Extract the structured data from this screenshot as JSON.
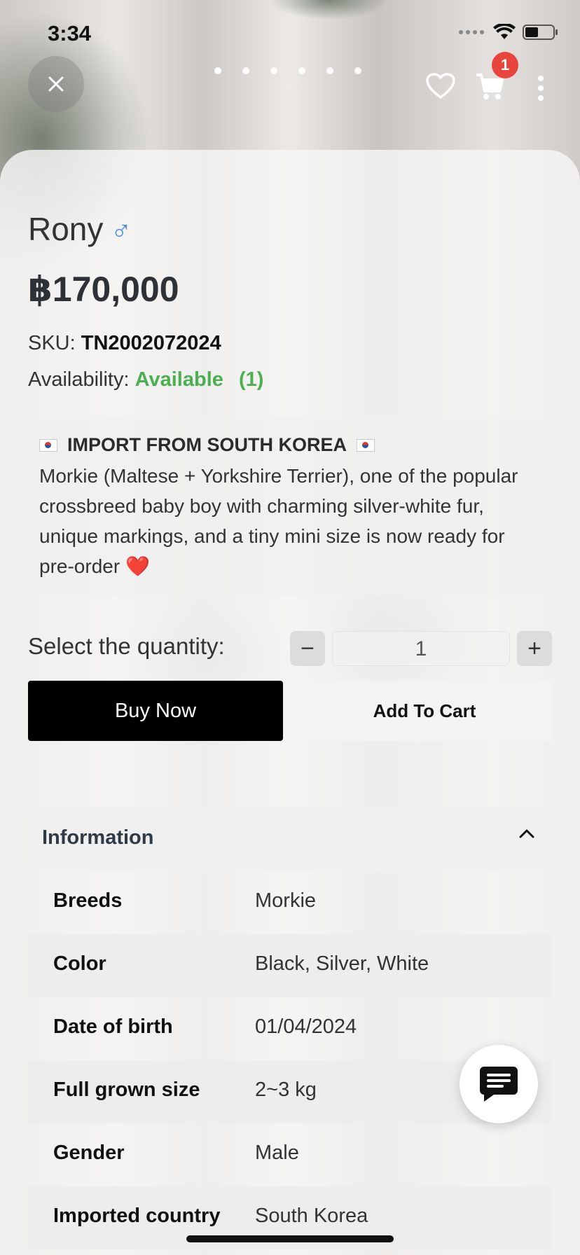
{
  "status_bar": {
    "time": "3:34"
  },
  "gallery": {
    "dot_count": 6,
    "active_index": 0
  },
  "cart": {
    "badge_count": "1"
  },
  "product": {
    "name": "Rony",
    "gender_symbol": "♂",
    "price": "฿170,000",
    "sku_label": "SKU:",
    "sku_value": "TN2002072024",
    "availability_label": "Availability:",
    "availability_value": "Available",
    "availability_count": "(1)",
    "description_title": "IMPORT FROM SOUTH KOREA",
    "description_text": "Morkie (Maltese + Yorkshire Terrier), one of the popular crossbreed baby boy with charming silver-white fur, unique markings, and a tiny mini size is now ready for pre-order ❤️"
  },
  "quantity": {
    "label": "Select the quantity:",
    "value": "1",
    "minus": "−",
    "plus": "+"
  },
  "actions": {
    "buy_now": "Buy Now",
    "add_to_cart": "Add To Cart"
  },
  "information": {
    "title": "Information",
    "rows": [
      {
        "key": "Breeds",
        "value": "Morkie"
      },
      {
        "key": "Color",
        "value": "Black, Silver, White"
      },
      {
        "key": "Date of birth",
        "value": "01/04/2024"
      },
      {
        "key": "Full grown size",
        "value": "2~3 kg"
      },
      {
        "key": "Gender",
        "value": "Male"
      },
      {
        "key": "Imported country",
        "value": "South Korea"
      }
    ]
  },
  "colors": {
    "available_green": "#4caf50",
    "badge_red": "#e8453c",
    "male_blue": "#4a90e2"
  },
  "icons": [
    "close-icon",
    "heart-icon",
    "cart-icon",
    "more-vertical-icon",
    "chevron-up-icon",
    "chat-icon",
    "wifi-icon",
    "battery-icon",
    "signal-icon",
    "flag-icon"
  ]
}
